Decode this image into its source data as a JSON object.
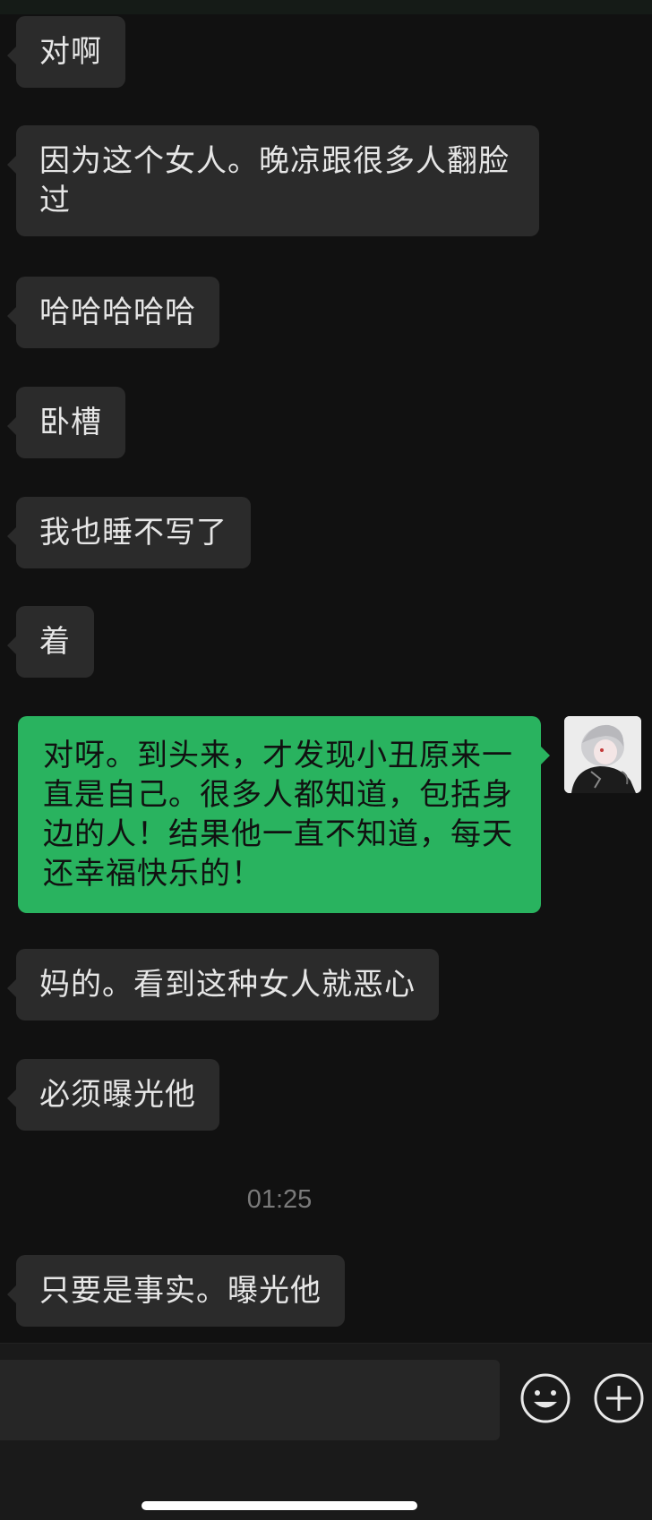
{
  "messages": [
    {
      "from": "other",
      "text": "对啊"
    },
    {
      "from": "other",
      "text": "因为这个女人。晚凉跟很多人翻脸过"
    },
    {
      "from": "other",
      "text": "哈哈哈哈哈"
    },
    {
      "from": "other",
      "text": "卧槽"
    },
    {
      "from": "other",
      "text": "我也睡不写了"
    },
    {
      "from": "other",
      "text": "着"
    },
    {
      "from": "me",
      "text": "对呀。到头来，才发现小丑原来一直是自己。很多人都知道，包括身边的人！结果他一直不知道，每天还幸福快乐的！"
    },
    {
      "from": "other",
      "text": "妈的。看到这种女人就恶心"
    },
    {
      "from": "other",
      "text": "必须曝光他"
    },
    {
      "from": "other",
      "text": "只要是事实。曝光他"
    }
  ],
  "timestamp": "01:25",
  "input": {
    "value": "",
    "placeholder": ""
  },
  "icons": {
    "emoji": "smiley-face-icon",
    "more": "plus-circle-icon"
  },
  "colors": {
    "background": "#111111",
    "bubble_other": "#2b2b2b",
    "bubble_me": "#29b35f",
    "text_other": "#e6e6e6"
  }
}
